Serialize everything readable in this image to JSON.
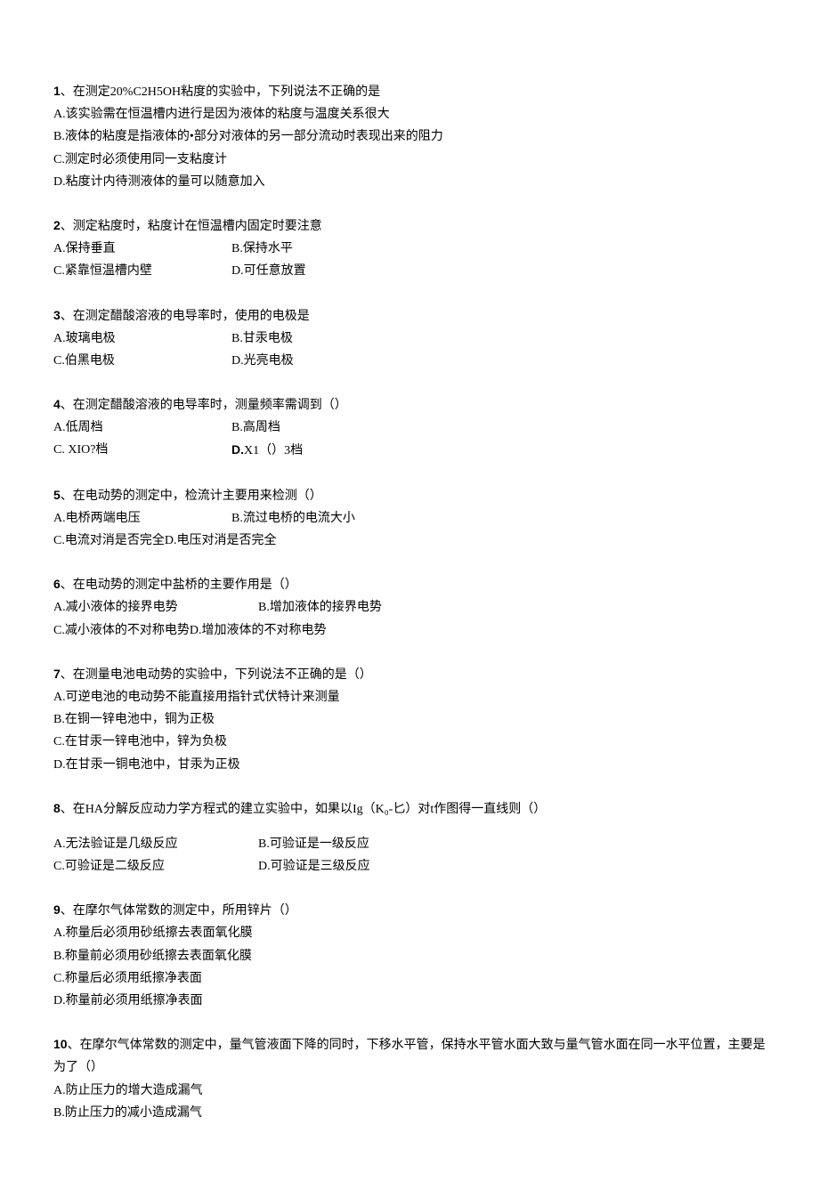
{
  "questions": [
    {
      "number": "1",
      "stem": "、在测定20%C2H5OH粘度的实验中，下列说法不正确的是",
      "options": [
        "A.该实验需在恒温槽内进行是因为液体的粘度与温度关系很大",
        "B.液体的粘度是指液体的•部分对液体的另一部分流动时表现出来的阻力",
        "C.测定时必须使用同一支粘度计",
        "D.粘度计内待测液体的量可以随意加入"
      ]
    },
    {
      "number": "2",
      "stem": "、测定粘度时，粘度计在恒温槽内固定时要注意",
      "pairs": [
        {
          "left": "A.保持垂直",
          "right": "B.保持水平"
        },
        {
          "left": "C.紧靠恒温槽内壁",
          "right": "D.可任意放置"
        }
      ]
    },
    {
      "number": "3",
      "stem": "、在测定醋酸溶液的电导率时，使用的电极是",
      "pairs": [
        {
          "left": "A.玻璃电极",
          "right": "B.甘汞电极"
        },
        {
          "left": "C.伯黑电极",
          "right": "D.光亮电极"
        }
      ]
    },
    {
      "number": "4",
      "stem": "、在测定醋酸溶液的电导率时，测量频率需调到（）",
      "pairs": [
        {
          "left": "A.低周档",
          "right": "B.高周档"
        },
        {
          "left": "C.  XIO?档",
          "right_prefix": "D.",
          "right": "X1（）3档"
        }
      ]
    },
    {
      "number": "5",
      "stem": "、在电动势的测定中，检流计主要用来检测（）",
      "pairs": [
        {
          "left": "A.电桥两端电压",
          "right": "B.流过电桥的电流大小"
        }
      ],
      "tail": "C.电流对消是否完全D.电压对消是否完全"
    },
    {
      "number": "6",
      "stem": "、在电动势的测定中盐桥的主要作用是（）",
      "pairs": [
        {
          "left": "A.减小液体的接界电势",
          "right": "B.增加液体的接界电势",
          "left_wide": true
        }
      ],
      "tail": "C.减小液体的不对称电势D.增加液体的不对称电势"
    },
    {
      "number": "7",
      "stem": "、在测量电池电动势的实验中，下列说法不正确的是（）",
      "options": [
        "A.可逆电池的电动势不能直接用指针式伏特计来测量",
        "B.在铜一锌电池中，铜为正极",
        "C.在甘汞一锌电池中，锌为负极",
        "D.在甘汞一铜电池中，甘汞为正极"
      ]
    },
    {
      "number": "8",
      "stem": "、在HA分解反应动力学方程式的建立实验中，如果以Ig（K₀-匕）对t作图得一直线则（）",
      "extra_gap": true,
      "pairs": [
        {
          "left": "A.无法验证是几级反应",
          "right": "B.可验证是一级反应",
          "left_wide": true
        },
        {
          "left": "C.可验证是二级反应",
          "right": "D.可验证是三级反应",
          "left_wide": true
        }
      ]
    },
    {
      "number": "9",
      "stem": "、在摩尔气体常数的测定中，所用锌片（）",
      "options": [
        "A.称量后必须用砂纸擦去表面氧化膜",
        "B.称量前必须用砂纸擦去表面氧化膜",
        "C.称量后必须用纸擦净表面",
        "D.称量前必须用纸擦净表面"
      ]
    },
    {
      "number": "10",
      "stem": "、在摩尔气体常数的测定中，量气管液面下降的同时，下移水平管，保持水平管水面大致与量气管水面在同一水平位置，主要是为了（）",
      "options": [
        "A.防止压力的增大造成漏气",
        "B.防止压力的减小造成漏气"
      ]
    }
  ]
}
